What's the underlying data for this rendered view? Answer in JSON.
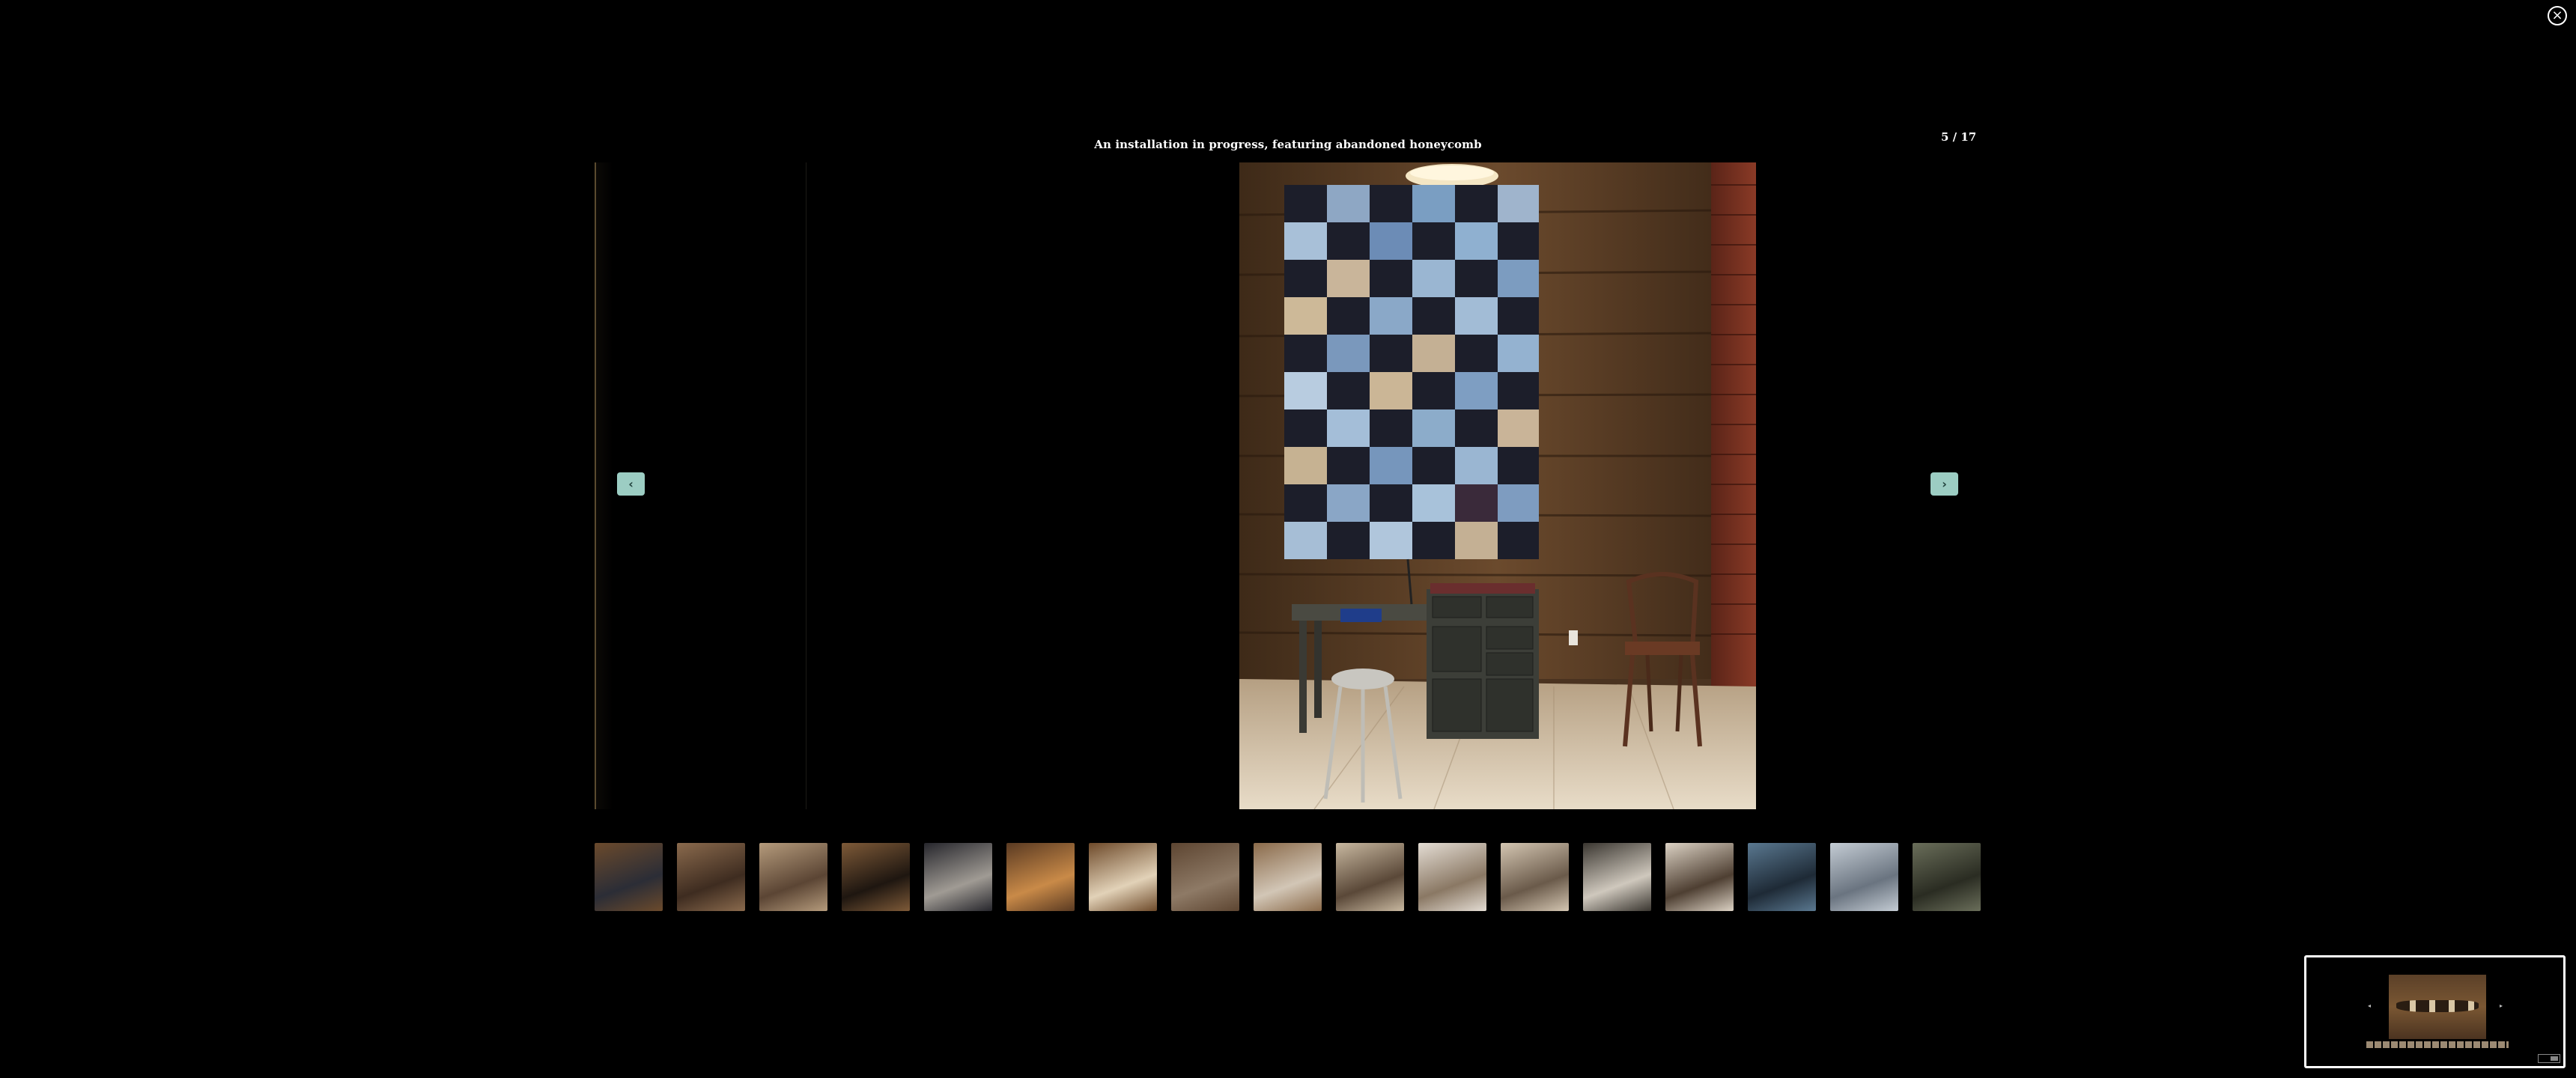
{
  "lightbox": {
    "caption": "An installation in progress, featuring abandoned honeycomb",
    "counter": "5 / 17",
    "close_icon": "close-icon",
    "prev_icon": "chevron-left-icon",
    "next_icon": "chevron-right-icon",
    "accent_color": "#9ccdc3"
  },
  "thumbnails": [
    {
      "name": "thumb-1",
      "colors": [
        "#6b4a2c",
        "#2b2d36"
      ]
    },
    {
      "name": "thumb-2",
      "colors": [
        "#8a6a4d",
        "#3e2c20"
      ]
    },
    {
      "name": "thumb-3",
      "colors": [
        "#b59b7c",
        "#5b4534"
      ]
    },
    {
      "name": "thumb-4",
      "colors": [
        "#7e5a38",
        "#1e1610"
      ]
    },
    {
      "name": "thumb-5",
      "colors": [
        "#26262c",
        "#a09b94"
      ]
    },
    {
      "name": "thumb-6",
      "colors": [
        "#5a3a22",
        "#c98a48"
      ]
    },
    {
      "name": "thumb-7",
      "colors": [
        "#6e4a2a",
        "#e2d2b8"
      ]
    },
    {
      "name": "thumb-8",
      "colors": [
        "#5d4531",
        "#8e7a66"
      ]
    },
    {
      "name": "thumb-9",
      "colors": [
        "#8a6a4a",
        "#d2c6b6"
      ]
    },
    {
      "name": "thumb-10",
      "colors": [
        "#c8b8a0",
        "#5a4838"
      ]
    },
    {
      "name": "thumb-11",
      "colors": [
        "#e4ddd4",
        "#8a7864"
      ]
    },
    {
      "name": "thumb-12",
      "colors": [
        "#d4c6b2",
        "#6a5a4a"
      ]
    },
    {
      "name": "thumb-13",
      "colors": [
        "#3a3630",
        "#cfc8bd"
      ]
    },
    {
      "name": "thumb-14",
      "colors": [
        "#dcd2c4",
        "#4e3f32"
      ]
    },
    {
      "name": "thumb-15",
      "colors": [
        "#5a7890",
        "#1e2a36"
      ]
    },
    {
      "name": "thumb-16",
      "colors": [
        "#c4ccd4",
        "#6a7480"
      ]
    },
    {
      "name": "thumb-17",
      "colors": [
        "#6a6e5a",
        "#2a2c22"
      ]
    }
  ],
  "minimap": {
    "label_icon": "minimap-icon"
  }
}
